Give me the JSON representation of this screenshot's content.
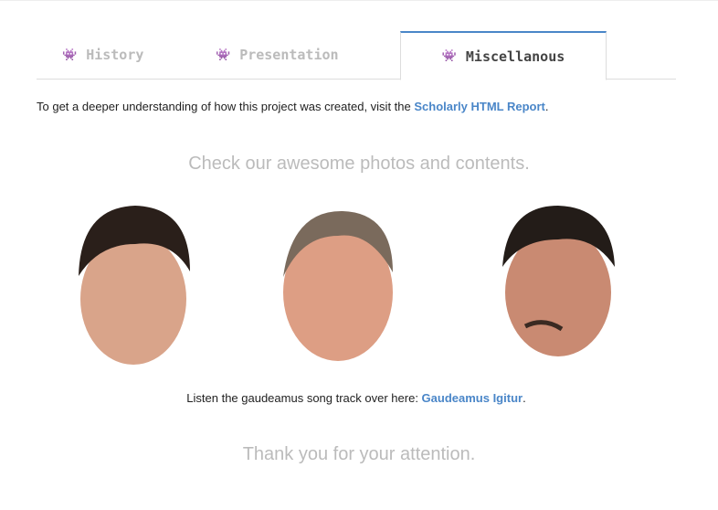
{
  "tabs": [
    {
      "label": "History",
      "icon": "space-invader-icon"
    },
    {
      "label": "Presentation",
      "icon": "space-invader-icon"
    },
    {
      "label": "Miscellanous",
      "icon": "space-invader-icon",
      "active": true
    }
  ],
  "intro": {
    "text": "To get a deeper understanding of how this project was created, visit the ",
    "link": "Scholarly HTML Report",
    "end": "."
  },
  "photos_heading": "Check our awesome photos and contents.",
  "listen": {
    "text": "Listen the gaudeamus song track over here: ",
    "link": "Gaudeamus Igitur",
    "end": "."
  },
  "footer": "Thank you for your attention.",
  "colors": {
    "accent": "#4a86c8",
    "muted": "#bbbbbb"
  }
}
